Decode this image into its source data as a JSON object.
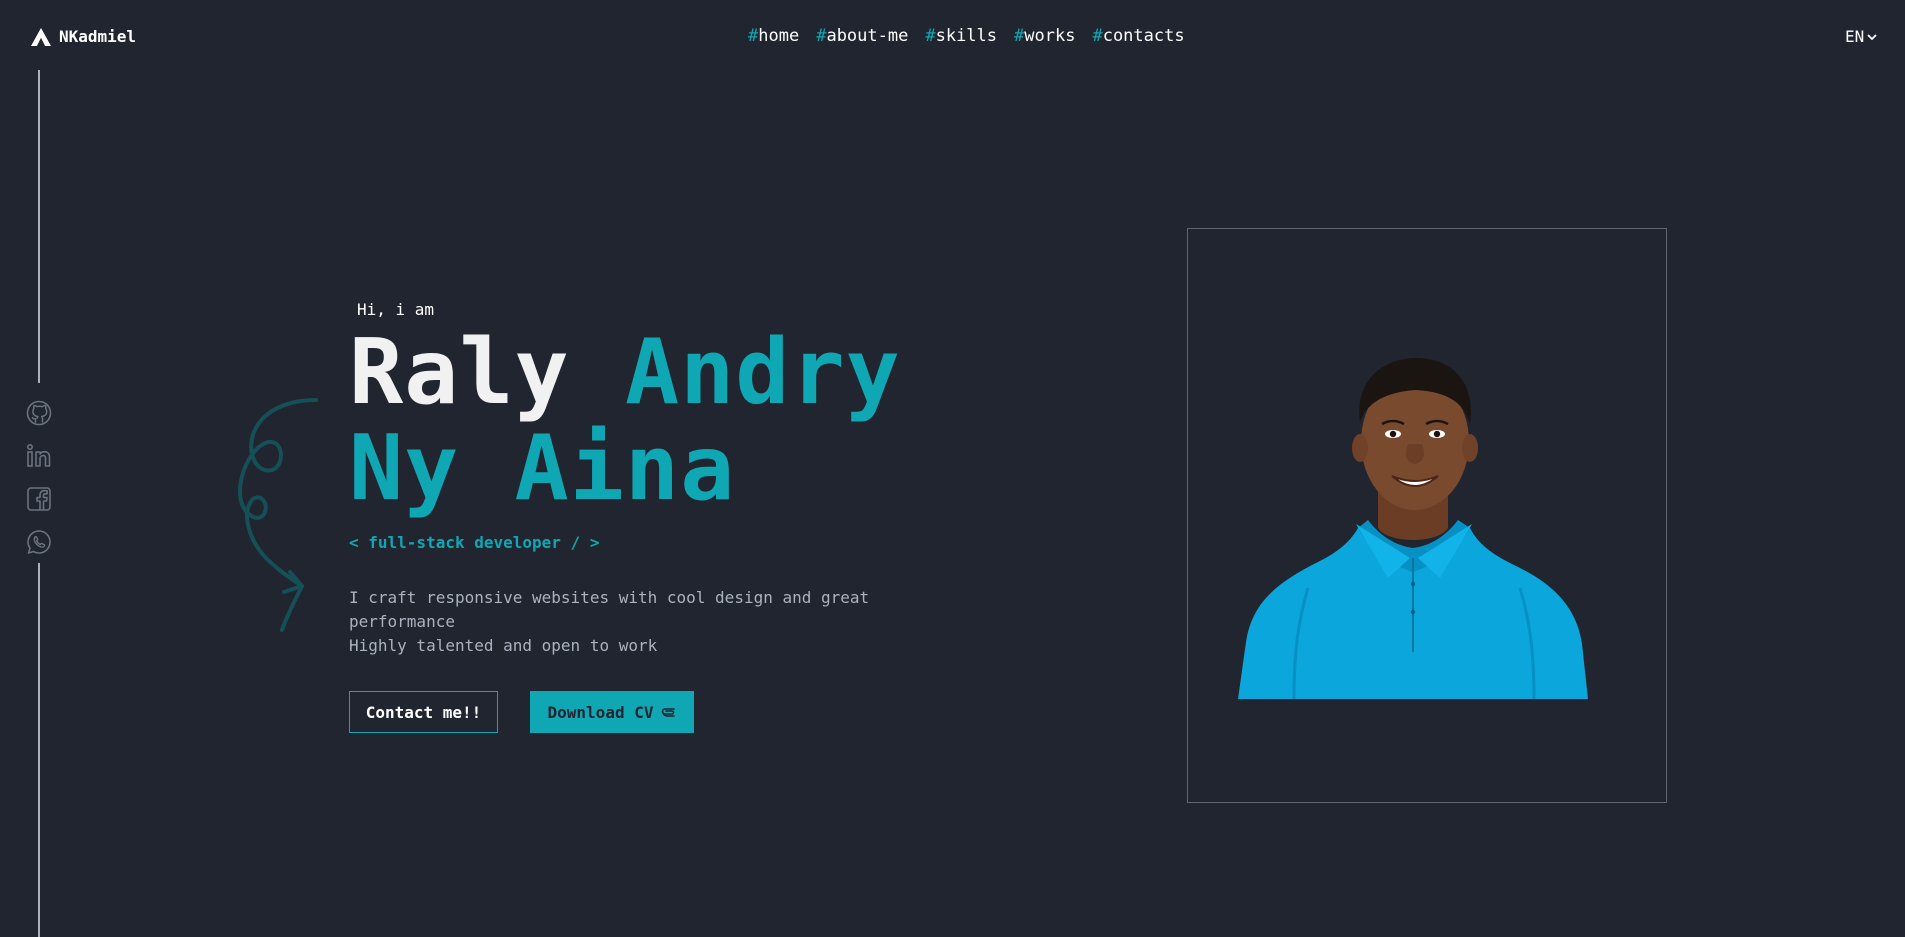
{
  "brand": {
    "name": "NKadmiel"
  },
  "nav": {
    "items": [
      {
        "hash": "#",
        "label": "home"
      },
      {
        "hash": "#",
        "label": "about-me"
      },
      {
        "hash": "#",
        "label": "skills"
      },
      {
        "hash": "#",
        "label": "works"
      },
      {
        "hash": "#",
        "label": "contacts"
      }
    ],
    "language": "EN"
  },
  "socials": [
    "github-icon",
    "linkedin-icon",
    "facebook-icon",
    "whatsapp-icon"
  ],
  "hero": {
    "greeting": "Hi, i am",
    "name_first": "Raly",
    "name_rest_line1": "Andry",
    "name_line2": "Ny Aina",
    "role": "< full-stack developer / >",
    "description_line1": "I craft responsive websites with cool design and great performance",
    "description_line2": "Highly talented and open to work",
    "contact_button": "Contact me!!",
    "download_button": "Download CV"
  },
  "colors": {
    "background": "#21252f",
    "accent": "#10a7b4",
    "text": "#ffffff",
    "muted": "#abb2bf"
  }
}
